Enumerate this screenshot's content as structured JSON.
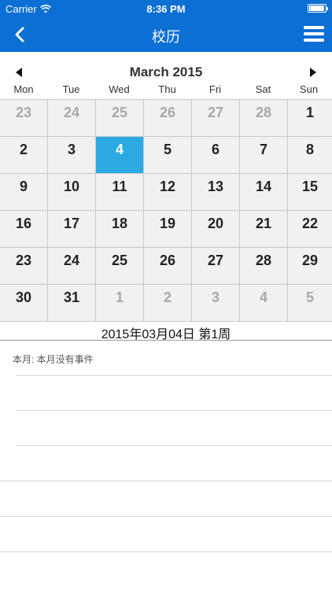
{
  "status": {
    "carrier": "Carrier",
    "time": "8:36 PM"
  },
  "nav": {
    "title": "校历",
    "back_icon": "chevron-left-icon",
    "menu_icon": "hamburger-menu-icon"
  },
  "calendar": {
    "month_title": "March 2015",
    "weekdays": [
      "Mon",
      "Tue",
      "Wed",
      "Thu",
      "Fri",
      "Sat",
      "Sun"
    ],
    "weeks": [
      [
        {
          "d": "23",
          "o": true
        },
        {
          "d": "24",
          "o": true
        },
        {
          "d": "25",
          "o": true
        },
        {
          "d": "26",
          "o": true
        },
        {
          "d": "27",
          "o": true
        },
        {
          "d": "28",
          "o": true
        },
        {
          "d": "1",
          "o": false
        }
      ],
      [
        {
          "d": "2",
          "o": false
        },
        {
          "d": "3",
          "o": false
        },
        {
          "d": "4",
          "o": false,
          "sel": true
        },
        {
          "d": "5",
          "o": false
        },
        {
          "d": "6",
          "o": false
        },
        {
          "d": "7",
          "o": false
        },
        {
          "d": "8",
          "o": false
        }
      ],
      [
        {
          "d": "9",
          "o": false
        },
        {
          "d": "10",
          "o": false
        },
        {
          "d": "11",
          "o": false
        },
        {
          "d": "12",
          "o": false
        },
        {
          "d": "13",
          "o": false
        },
        {
          "d": "14",
          "o": false
        },
        {
          "d": "15",
          "o": false
        }
      ],
      [
        {
          "d": "16",
          "o": false
        },
        {
          "d": "17",
          "o": false
        },
        {
          "d": "18",
          "o": false
        },
        {
          "d": "19",
          "o": false
        },
        {
          "d": "20",
          "o": false
        },
        {
          "d": "21",
          "o": false
        },
        {
          "d": "22",
          "o": false
        }
      ],
      [
        {
          "d": "23",
          "o": false
        },
        {
          "d": "24",
          "o": false
        },
        {
          "d": "25",
          "o": false
        },
        {
          "d": "26",
          "o": false
        },
        {
          "d": "27",
          "o": false
        },
        {
          "d": "28",
          "o": false
        },
        {
          "d": "29",
          "o": false
        }
      ],
      [
        {
          "d": "30",
          "o": false
        },
        {
          "d": "31",
          "o": false
        },
        {
          "d": "1",
          "o": true
        },
        {
          "d": "2",
          "o": true
        },
        {
          "d": "3",
          "o": true
        },
        {
          "d": "4",
          "o": true
        },
        {
          "d": "5",
          "o": true
        }
      ]
    ],
    "selected_date_text": "2015年03月04日 第1周"
  },
  "events": {
    "summary": "本月: 本月没有事件"
  },
  "colors": {
    "nav_bg": "#0c6fd4",
    "selected_day": "#2aa9e3"
  }
}
